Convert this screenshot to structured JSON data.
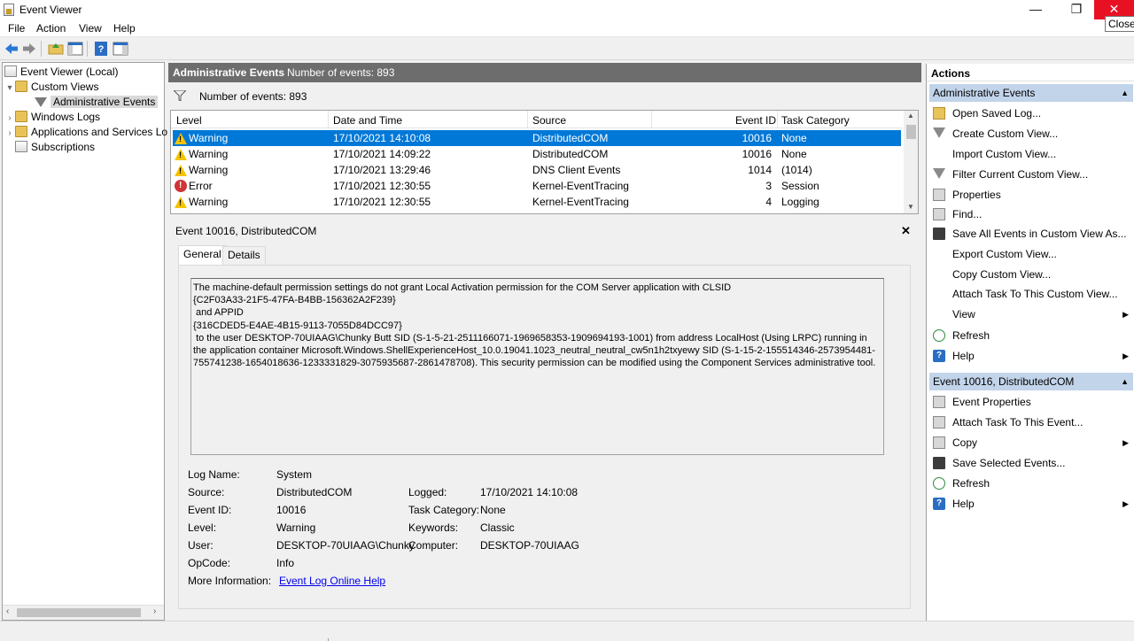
{
  "window": {
    "title": "Event Viewer",
    "minimize_glyph": "—",
    "maximize_glyph": "❐",
    "close_glyph": "✕",
    "close_tooltip": "Close"
  },
  "menu": [
    "File",
    "Action",
    "View",
    "Help"
  ],
  "toolbar": [
    "back-arrow-icon",
    "forward-arrow-icon",
    "open-folder-icon",
    "show-hide-tree-icon",
    "help-icon",
    "show-hide-action-pane-icon"
  ],
  "tree": {
    "root": "Event Viewer (Local)",
    "custom_views": "Custom Views",
    "admin_events": "Administrative Events",
    "windows_logs": "Windows Logs",
    "apps_services": "Applications and Services Lo",
    "subscriptions": "Subscriptions"
  },
  "center": {
    "header_title": "Administrative Events",
    "header_count": "Number of events: 893",
    "filter_count": "Number of events: 893",
    "columns": [
      "Level",
      "Date and Time",
      "Source",
      "Event ID",
      "Task Category"
    ],
    "rows": [
      {
        "level": "Warning",
        "type": "warning",
        "date": "17/10/2021 14:10:08",
        "source": "DistributedCOM",
        "id": "10016",
        "category": "None"
      },
      {
        "level": "Warning",
        "type": "warning",
        "date": "17/10/2021 14:09:22",
        "source": "DistributedCOM",
        "id": "10016",
        "category": "None"
      },
      {
        "level": "Warning",
        "type": "warning",
        "date": "17/10/2021 13:29:46",
        "source": "DNS Client Events",
        "id": "1014",
        "category": "(1014)"
      },
      {
        "level": "Error",
        "type": "error",
        "date": "17/10/2021 12:30:55",
        "source": "Kernel-EventTracing",
        "id": "3",
        "category": "Session"
      },
      {
        "level": "Warning",
        "type": "warning",
        "date": "17/10/2021 12:30:55",
        "source": "Kernel-EventTracing",
        "id": "4",
        "category": "Logging"
      }
    ]
  },
  "detail": {
    "header": "Event 10016, DistributedCOM",
    "close_glyph": "✕",
    "tabs": [
      "General",
      "Details"
    ],
    "description": [
      "The machine-default permission settings do not grant Local Activation permission for the COM Server application with CLSID",
      "{C2F03A33-21F5-47FA-B4BB-156362A2F239}",
      " and APPID",
      "{316CDED5-E4AE-4B15-9113-7055D84DCC97}",
      " to the user DESKTOP-70UIAAG\\Chunky Butt SID (S-1-5-21-2511166071-1969658353-1909694193-1001) from address LocalHost (Using LRPC) running in the application container Microsoft.Windows.ShellExperienceHost_10.0.19041.1023_neutral_neutral_cw5n1h2txyewy SID (S-1-15-2-155514346-2573954481-755741238-1654018636-1233331829-3075935687-2861478708). This security permission can be modified using the Component Services administrative tool."
    ],
    "fields": {
      "log_name_label": "Log Name:",
      "log_name": "System",
      "source_label": "Source:",
      "source": "DistributedCOM",
      "logged_label": "Logged:",
      "logged": "17/10/2021 14:10:08",
      "event_id_label": "Event ID:",
      "event_id": "10016",
      "task_category_label": "Task Category:",
      "task_category": "None",
      "level_label": "Level:",
      "level": "Warning",
      "keywords_label": "Keywords:",
      "keywords": "Classic",
      "user_label": "User:",
      "user": "DESKTOP-70UIAAG\\Chunky",
      "computer_label": "Computer:",
      "computer": "DESKTOP-70UIAAG",
      "opcode_label": "OpCode:",
      "opcode": "Info",
      "more_info_label": "More Information:",
      "more_info_link": "Event Log Online Help"
    }
  },
  "actions": {
    "title": "Actions",
    "section1": {
      "title": "Administrative Events",
      "items": [
        {
          "label": "Open Saved Log...",
          "icon": "open-folder-icon"
        },
        {
          "label": "Create Custom View...",
          "icon": "funnel-icon"
        },
        {
          "label": "Import Custom View...",
          "icon": ""
        },
        {
          "label": "Filter Current Custom View...",
          "icon": "funnel-icon"
        },
        {
          "label": "Properties",
          "icon": "properties-icon"
        },
        {
          "label": "Find...",
          "icon": "binoculars-icon"
        },
        {
          "label": "Save All Events in Custom View As...",
          "icon": "disk-icon"
        },
        {
          "label": "Export Custom View...",
          "icon": ""
        },
        {
          "label": "Copy Custom View...",
          "icon": ""
        },
        {
          "label": "Attach Task To This Custom View...",
          "icon": ""
        },
        {
          "label": "View",
          "icon": "",
          "submenu": true
        },
        {
          "label": "Refresh",
          "icon": "refresh-icon"
        },
        {
          "label": "Help",
          "icon": "help-icon",
          "submenu": true
        }
      ]
    },
    "section2": {
      "title": "Event 10016, DistributedCOM",
      "items": [
        {
          "label": "Event Properties",
          "icon": "properties-icon"
        },
        {
          "label": "Attach Task To This Event...",
          "icon": "task-icon"
        },
        {
          "label": "Copy",
          "icon": "copy-icon",
          "submenu": true
        },
        {
          "label": "Save Selected Events...",
          "icon": "disk-icon"
        },
        {
          "label": "Refresh",
          "icon": "refresh-icon"
        },
        {
          "label": "Help",
          "icon": "help-icon",
          "submenu": true
        }
      ]
    }
  },
  "colors": {
    "selection": "#0078d7",
    "header_gray": "#6d6d6d",
    "section_blue": "#c2d4ea",
    "close_red": "#e81123",
    "link": "#0000ee"
  }
}
